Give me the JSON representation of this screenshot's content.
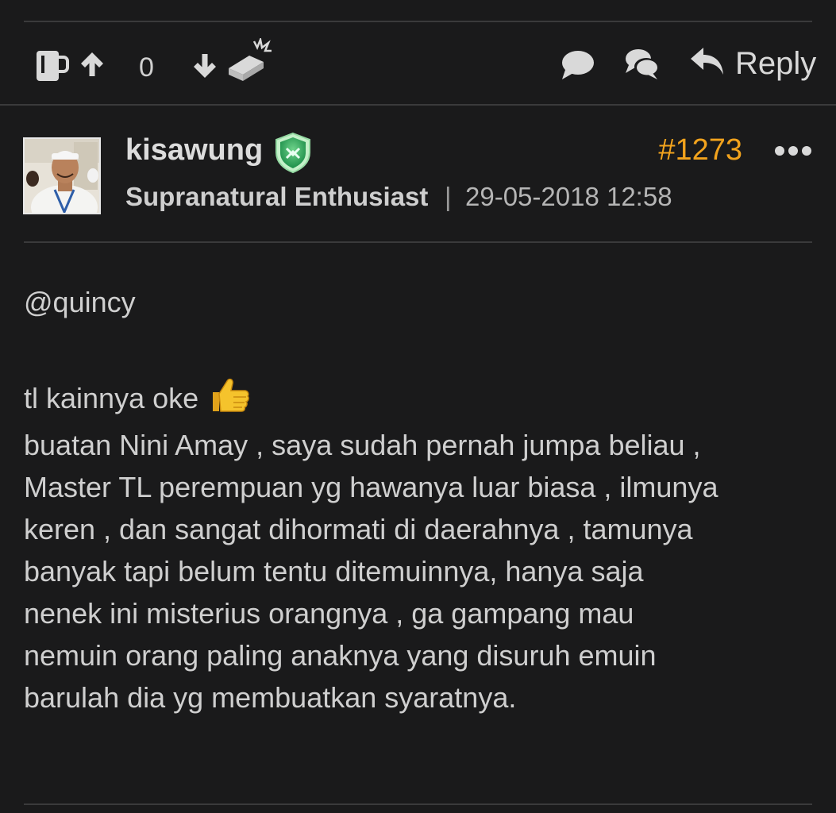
{
  "actionbar": {
    "vote_count": "0",
    "reply_label": "Reply",
    "icons": [
      "mug-icon",
      "upvote-arrow-icon",
      "downvote-arrow-icon",
      "brick-icon",
      "comment-bubble-icon",
      "multi-comment-icon",
      "reply-arrow-icon"
    ]
  },
  "post": {
    "username": "kisawung",
    "user_title": "Supranatural Enthusiast",
    "separator": "|",
    "timestamp": "29-05-2018 12:58",
    "post_number": "#1273",
    "badge_icon": "shield-badge-icon",
    "accent_color": "#f2a31d",
    "body": {
      "mention": "@quincy",
      "line1": "tl kainnya oke",
      "line2": "buatan Nini Amay , saya sudah pernah jumpa beliau ,",
      "line3": "Master TL perempuan yg hawanya luar biasa , ilmunya",
      "line4": "keren , dan sangat dihormati di daerahnya , tamunya",
      "line5": "banyak tapi belum tentu ditemuinnya, hanya saja",
      "line6": "nenek ini misterius orangnya , ga gampang mau",
      "line7": "nemuin orang paling anaknya yang disuruh emuin",
      "line8": "barulah dia yg membuatkan syaratnya."
    }
  },
  "colors": {
    "background": "#1a1a1b",
    "text": "#cfcfcf",
    "divider": "#3a3a3b"
  }
}
